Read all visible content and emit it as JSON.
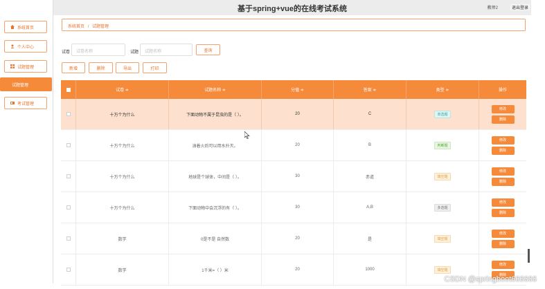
{
  "header": {
    "title": "基于spring+vue的在线考试系统",
    "user": "教师2",
    "logout": "退出登录"
  },
  "sidebar": {
    "items": [
      {
        "label": "系统首页",
        "icon": "home-icon"
      },
      {
        "label": "个人中心",
        "icon": "user-icon"
      },
      {
        "label": "试题管理",
        "icon": "grid-icon"
      },
      {
        "label": "试题管理",
        "icon": ""
      },
      {
        "label": "考试管理",
        "icon": "exam-icon"
      }
    ]
  },
  "breadcrumb": {
    "home": "系统首页",
    "sep": "/",
    "current": "试题管理"
  },
  "filters": {
    "paper_label": "试卷",
    "paper_placeholder": "试卷名称",
    "question_label": "试题",
    "question_placeholder": "试题名称",
    "search_label": "查询"
  },
  "toolbar": {
    "add": "新增",
    "delete": "删除",
    "export": "导出",
    "print": "打印"
  },
  "table": {
    "columns": [
      "试卷 ≑",
      "试题名称 ≑",
      "分值 ≑",
      "答案 ≑",
      "类型 ≑",
      "操作"
    ],
    "rows": [
      {
        "paper": "十万个为什么",
        "name": "下面动物不属于昆虫的是（ ）。",
        "score": "20",
        "answer": "C",
        "type": "单选题",
        "tag": "single"
      },
      {
        "paper": "十万个为什么",
        "name": "油着火后可以用水扑灭。",
        "score": "20",
        "answer": "B",
        "type": "判断题",
        "tag": "judge"
      },
      {
        "paper": "十万个为什么",
        "name": "地球是个球体，中间是（ ）。",
        "score": "30",
        "answer": "赤道",
        "type": "填空题",
        "tag": "fill"
      },
      {
        "paper": "十万个为什么",
        "name": "下面动物中会沉浮的有（ ）。",
        "score": "30",
        "answer": "A,B",
        "type": "多选题",
        "tag": "multi"
      },
      {
        "paper": "数学",
        "name": "0是不是 自然数",
        "score": "20",
        "answer": "是",
        "type": "填空题",
        "tag": "fill"
      },
      {
        "paper": "数学",
        "name": "1千米=（ ）米",
        "score": "20",
        "answer": "1000",
        "type": "填空题",
        "tag": "fill"
      }
    ],
    "edit_label": "修改",
    "delete_label": "删除"
  },
  "watermark": "CSDN @springboot666666"
}
